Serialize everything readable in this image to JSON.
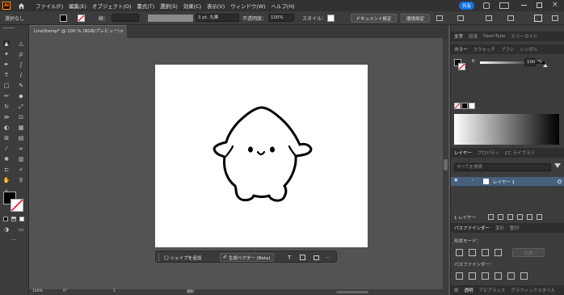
{
  "app": {
    "logo": "Ai",
    "menu": [
      "ファイル(F)",
      "編集(E)",
      "オブジェクト(O)",
      "書式(T)",
      "選択(S)",
      "効果(C)",
      "表示(V)",
      "ウィンドウ(W)",
      "ヘルプ(H)"
    ],
    "share_label": "共有"
  },
  "control_bar": {
    "selection_label": "選択なし",
    "stroke_label": "線：",
    "stroke_value": "",
    "brush_value": "3 pt. 丸筆",
    "opacity_label": "不透明度：",
    "opacity_value": "100%",
    "style_label": "スタイル：",
    "doc_settings_label": "ドキュメント設定",
    "prefs_label": "環境設定"
  },
  "document": {
    "tab_label": "LineStamp* @ 100 % (RGB/プレビュー)",
    "close_glyph": "×"
  },
  "contextual_taskbar": {
    "add_shape_label": "シェイプを追加",
    "vectorize_label": "生成ベクター (Beta)",
    "text_glyph": "T",
    "more_glyph": "···"
  },
  "status_bar": {
    "zoom": "100%",
    "angle": "0°",
    "page": "1",
    "tool_name": "選択"
  },
  "right_panel": {
    "top_tabs": [
      "文字",
      "段落",
      "OpenType",
      "カラーガイド"
    ],
    "color_tabs": [
      "カラー",
      "スウォッチ",
      "ブラシ",
      "シンボル"
    ],
    "k_label": "K",
    "k_value": "100",
    "k_unit": "%",
    "layer_tabs": [
      "レイヤー",
      "プロパティ",
      "CC ライブラリ"
    ],
    "layer_search_placeholder": "すべてを検索",
    "layer_name": "レイヤー 1",
    "layer_count": "1 レイヤー",
    "pathfinder_tabs": [
      "パスファインダー",
      "変形",
      "整列"
    ],
    "shape_mode_label": "形状モード：",
    "expand_label": "拡張",
    "pathfinder_label": "パスファインダー：",
    "bottom_tabs": [
      "線",
      "透明",
      "アピアランス",
      "グラフィックスタイル"
    ]
  }
}
